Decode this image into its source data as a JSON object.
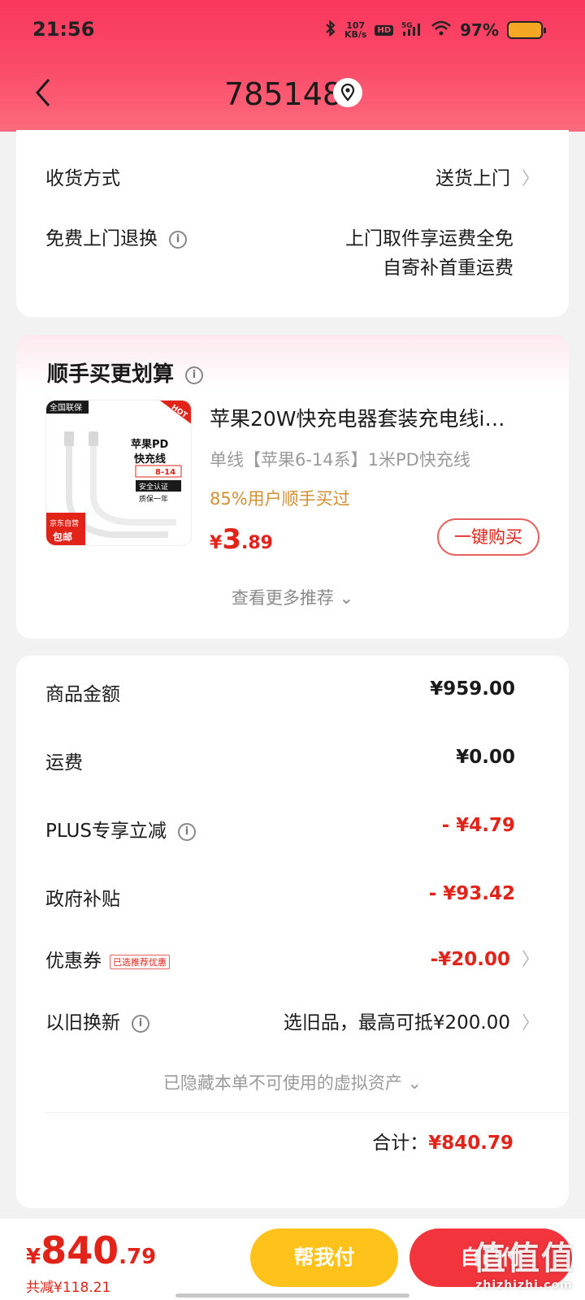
{
  "status_bar": {
    "time": "21:56",
    "network_speed": "107",
    "network_unit": "KB/s",
    "hd": "HD",
    "signal": "5G",
    "battery": "97%"
  },
  "header": {
    "title": "785148",
    "back_icon": "chevron-left-icon",
    "location_icon": "location-pin-icon"
  },
  "delivery": {
    "method_label": "收货方式",
    "method_value": "送货上门",
    "return_label": "免费上门退换",
    "return_line1": "上门取件享运费全免",
    "return_line2": "自寄补首重运费"
  },
  "recommend": {
    "title": "顺手买更划算",
    "product": {
      "name": "苹果20W快充电器套装充电线i…",
      "spec": "单线【苹果6-14系】1米PD快充线",
      "buyers": "85%用户顺手买过",
      "price_currency": "¥",
      "price_int": "3",
      "price_dec": ".89",
      "buy_label": "一键购买",
      "image_texts": {
        "badge_top": "全国联保",
        "hot": "HOT",
        "title1": "苹果PD",
        "title2": "快充线",
        "range": "8-14",
        "cert": "安全认证",
        "warranty": "质保一年",
        "jd": "京东自营",
        "free_ship": "包邮"
      }
    },
    "more_label": "查看更多推荐 ⌄"
  },
  "summary": {
    "goods_label": "商品金额",
    "goods_value": "¥959.00",
    "shipping_label": "运费",
    "shipping_value": "¥0.00",
    "plus_label": "PLUS专享立减",
    "plus_value": "- ¥4.79",
    "subsidy_label": "政府补贴",
    "subsidy_value": "- ¥93.42",
    "coupon_label": "优惠券",
    "coupon_tag": "已选推荐优惠",
    "coupon_value": "-¥20.00",
    "tradein_label": "以旧换新",
    "tradein_value": "选旧品，最高可抵¥200.00",
    "hidden_note": "已隐藏本单不可使用的虚拟资产 ⌄",
    "total_label": "合计：",
    "total_value": "¥840.79"
  },
  "bottom_bar": {
    "price_currency": "¥",
    "price_int": "840",
    "price_dec": ".79",
    "saved": "共减¥118.21",
    "help_pay": "帮我付",
    "pay": "自己付"
  },
  "watermark": {
    "line1": "值值值",
    "line2": "zhizhizhi.com"
  },
  "colors": {
    "accent_red": "#e2231a",
    "header_pink": "#fb4d6a",
    "help_yellow": "#ffc21a",
    "pay_red": "#f2353d",
    "buyers_orange": "#d09033"
  }
}
